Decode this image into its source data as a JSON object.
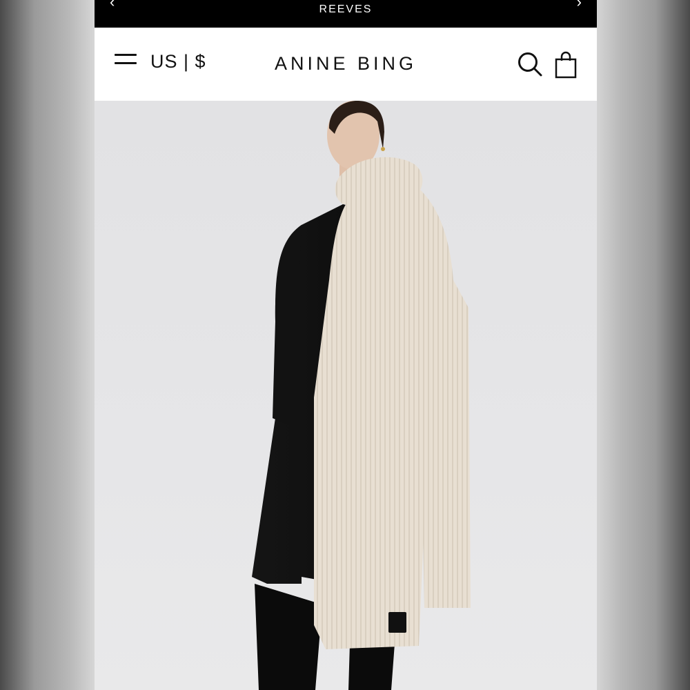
{
  "promo_bar": {
    "text": "REEVES",
    "prev_icon": "chevron-left-icon",
    "next_icon": "chevron-right-icon"
  },
  "header": {
    "menu_icon": "hamburger-menu-icon",
    "locale": "US | $",
    "brand": "ANINE BING",
    "search_icon": "search-icon",
    "bag_icon": "shopping-bag-icon"
  },
  "hero": {
    "image": "model wearing long cream ribbed scarf over black coat"
  },
  "colors": {
    "promo_bg": "#000000",
    "header_bg": "#ffffff",
    "text": "#111111",
    "hero_bg": "#e4e4e6",
    "scarf": "#e6ddd0",
    "coat": "#0e0e0e"
  }
}
